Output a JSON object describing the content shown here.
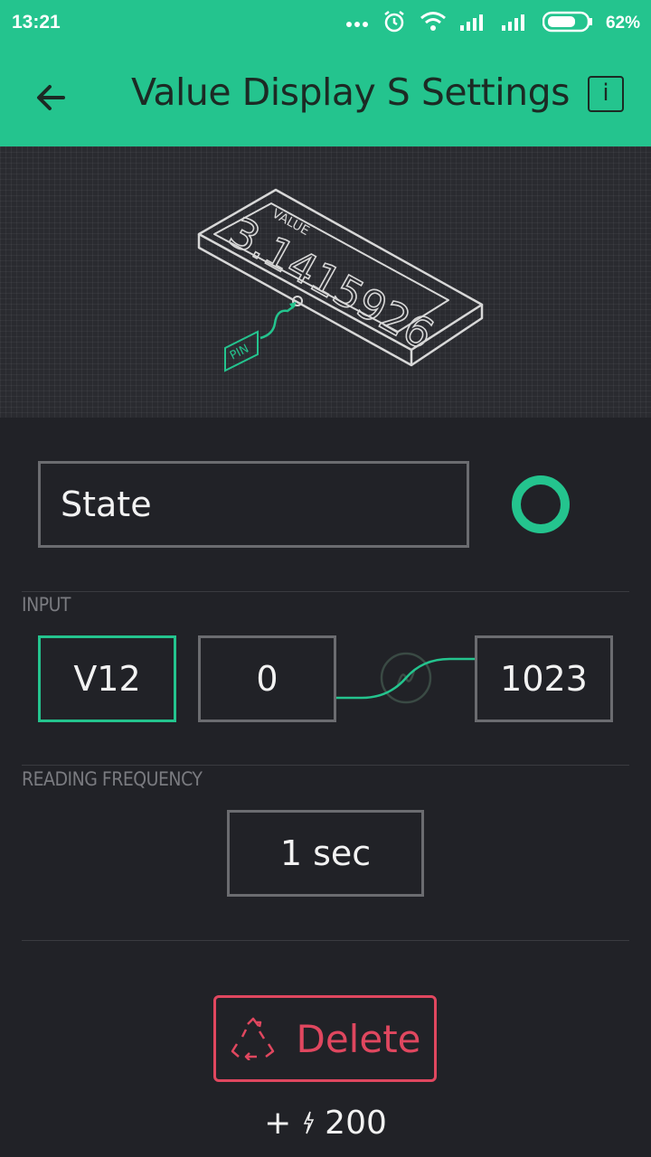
{
  "status": {
    "time": "13:21",
    "battery_pct": "62%"
  },
  "header": {
    "title": "Value Display S Settings",
    "info_label": "i"
  },
  "hero": {
    "value_label": "VALUE",
    "value_number": "3.1415926",
    "pin_label": "PIN"
  },
  "widget": {
    "name": "State",
    "color": "#24c48e"
  },
  "input": {
    "section_label": "INPUT",
    "pin": "V12",
    "min": "0",
    "max": "1023"
  },
  "frequency": {
    "section_label": "READING FREQUENCY",
    "value": "1 sec"
  },
  "delete": {
    "label": "Delete"
  },
  "energy": {
    "prefix": "+",
    "amount": "200"
  },
  "colors": {
    "accent": "#24c48e",
    "danger": "#e0475f",
    "background": "#212227"
  }
}
